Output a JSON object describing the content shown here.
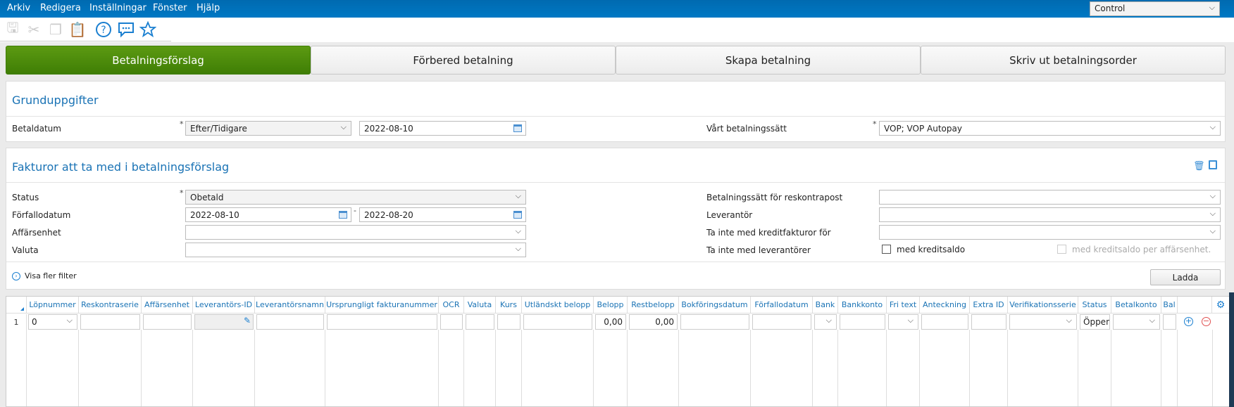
{
  "menu": [
    "Arkiv",
    "Redigera",
    "Inställningar",
    "Fönster",
    "Hjälp"
  ],
  "company_select": "Control",
  "toolbar_icons": [
    "save-icon",
    "cut-icon",
    "copy-icon",
    "paste-icon",
    "help-icon",
    "chat-icon",
    "star-icon"
  ],
  "tabs": [
    "Betalningsförslag",
    "Förbered betalning",
    "Skapa betalning",
    "Skriv ut betalningsorder"
  ],
  "grund": {
    "title": "Grunduppgifter",
    "betaldatum_label": "Betaldatum",
    "betaldatum_mode": "Efter/Tidigare",
    "betaldatum_date": "2022-08-10",
    "betalningssatt_label": "Vårt betalningssätt",
    "betalningssatt_value": "VOP; VOP Autopay",
    "required": "*"
  },
  "fakturor": {
    "title": "Fakturor att ta med i betalningsförslag",
    "status_label": "Status",
    "status_value": "Obetald",
    "forfallo_label": "Förfallodatum",
    "forfallo_from": "2022-08-10",
    "forfallo_to": "2022-08-20",
    "dash": "-",
    "affarsenhet_label": "Affärsenhet",
    "valuta_label": "Valuta",
    "reskontra_label": "Betalningssätt för reskontrapost",
    "leverantor_label": "Leverantör",
    "kredit_label": "Ta inte med kreditfakturor för",
    "levexcl_label": "Ta inte med leverantörer",
    "med_kreditsaldo": "med kreditsaldo",
    "med_kreditsaldo_per": "med kreditsaldo per affärsenhet.",
    "visa_fler": "Visa fler filter",
    "ladda": "Ladda"
  },
  "grid": {
    "columns": [
      "Löpnummer",
      "Reskontraserie",
      "Affärsenhet",
      "Leverantörs-ID",
      "Leverantörsnamn",
      "Ursprungligt fakturanummer",
      "OCR",
      "Valuta",
      "Kurs",
      "Utländskt belopp",
      "Belopp",
      "Restbelopp",
      "Bokföringsdatum",
      "Förfallodatum",
      "Bank",
      "Bankkonto",
      "Fri text",
      "Anteckning",
      "Extra ID",
      "Verifikationsserie",
      "Status",
      "Betalkonto",
      "Bal"
    ],
    "row": {
      "num": "1",
      "lopnummer": "0",
      "belopp": "0,00",
      "restbelopp": "0,00",
      "status": "Öppen"
    }
  }
}
